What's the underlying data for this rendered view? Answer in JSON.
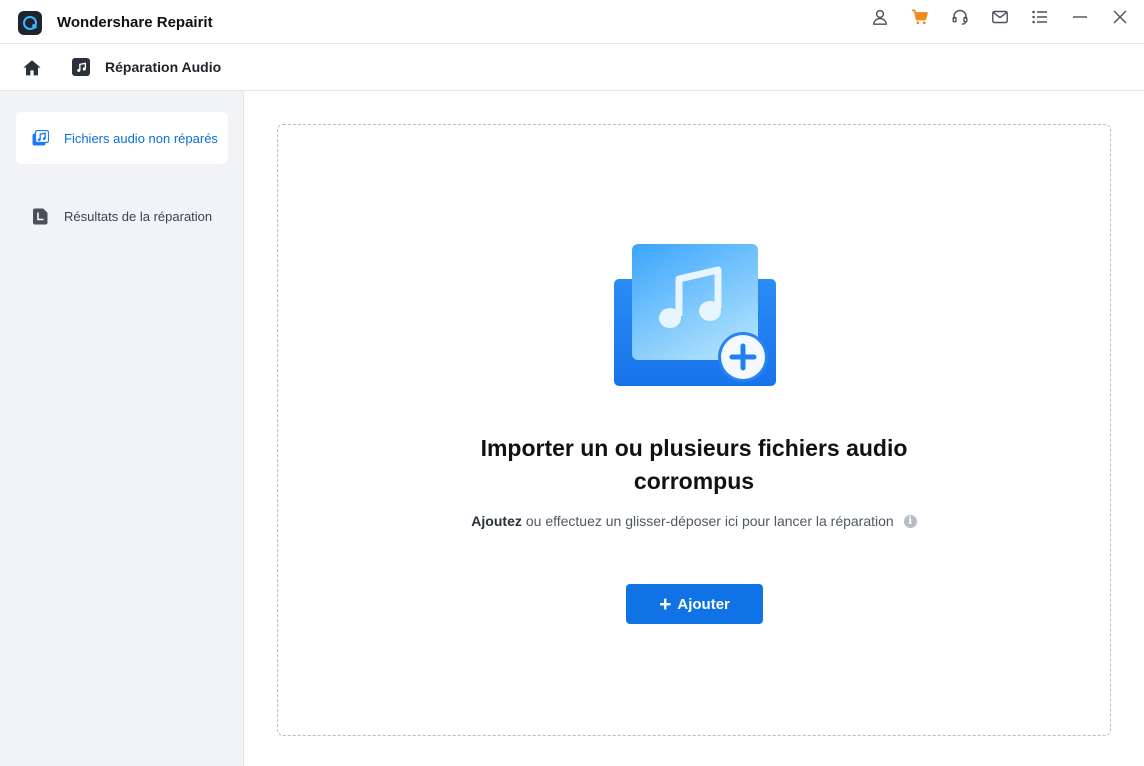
{
  "app": {
    "title": "Wondershare Repairit"
  },
  "titlebar_icons": [
    "user-icon",
    "cart-icon",
    "headset-icon",
    "mail-icon",
    "menu-icon",
    "minimize-icon",
    "close-icon"
  ],
  "breadcrumb": {
    "label": "Réparation Audio"
  },
  "sidebar": {
    "items": [
      {
        "label": "Fichiers audio non réparés",
        "icon": "audio-files-icon",
        "active": true
      },
      {
        "label": "Résultats de la réparation",
        "icon": "results-icon",
        "active": false
      }
    ]
  },
  "dropzone": {
    "title_line1": "Importer un ou plusieurs fichiers audio",
    "title_line2": "corrompus",
    "subtitle_strong": "Ajoutez",
    "subtitle_rest": "ou effectuez un glisser-déposer ici pour lancer la réparation",
    "add_button_label": "Ajouter"
  },
  "colors": {
    "accent": "#0f73e6",
    "cart": "#f08a1c",
    "sidebar_bg": "#f2f3f6",
    "active_text": "#0a6fd8"
  }
}
